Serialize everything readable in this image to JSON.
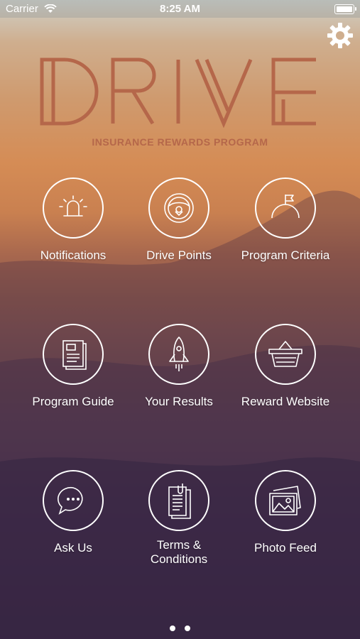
{
  "status_bar": {
    "carrier": "Carrier",
    "time": "8:25 AM"
  },
  "logo": {
    "text": "DRIVE",
    "subtitle": "INSURANCE REWARDS PROGRAM",
    "color": "#b5674a"
  },
  "tiles": [
    {
      "label": "Notifications",
      "icon": "siren-icon"
    },
    {
      "label": "Drive Points",
      "icon": "steering-wheel-icon"
    },
    {
      "label": "Program Criteria",
      "icon": "flag-hill-icon"
    },
    {
      "label": "Program Guide",
      "icon": "document-guide-icon"
    },
    {
      "label": "Your Results",
      "icon": "rocket-icon"
    },
    {
      "label": "Reward Website",
      "icon": "basket-icon"
    },
    {
      "label": "Ask Us",
      "icon": "chat-bubble-icon"
    },
    {
      "label": "Terms & Conditions",
      "icon": "clipboard-icon"
    },
    {
      "label": "Photo Feed",
      "icon": "photos-icon"
    }
  ],
  "pager": {
    "pages": 2,
    "current": 1
  }
}
